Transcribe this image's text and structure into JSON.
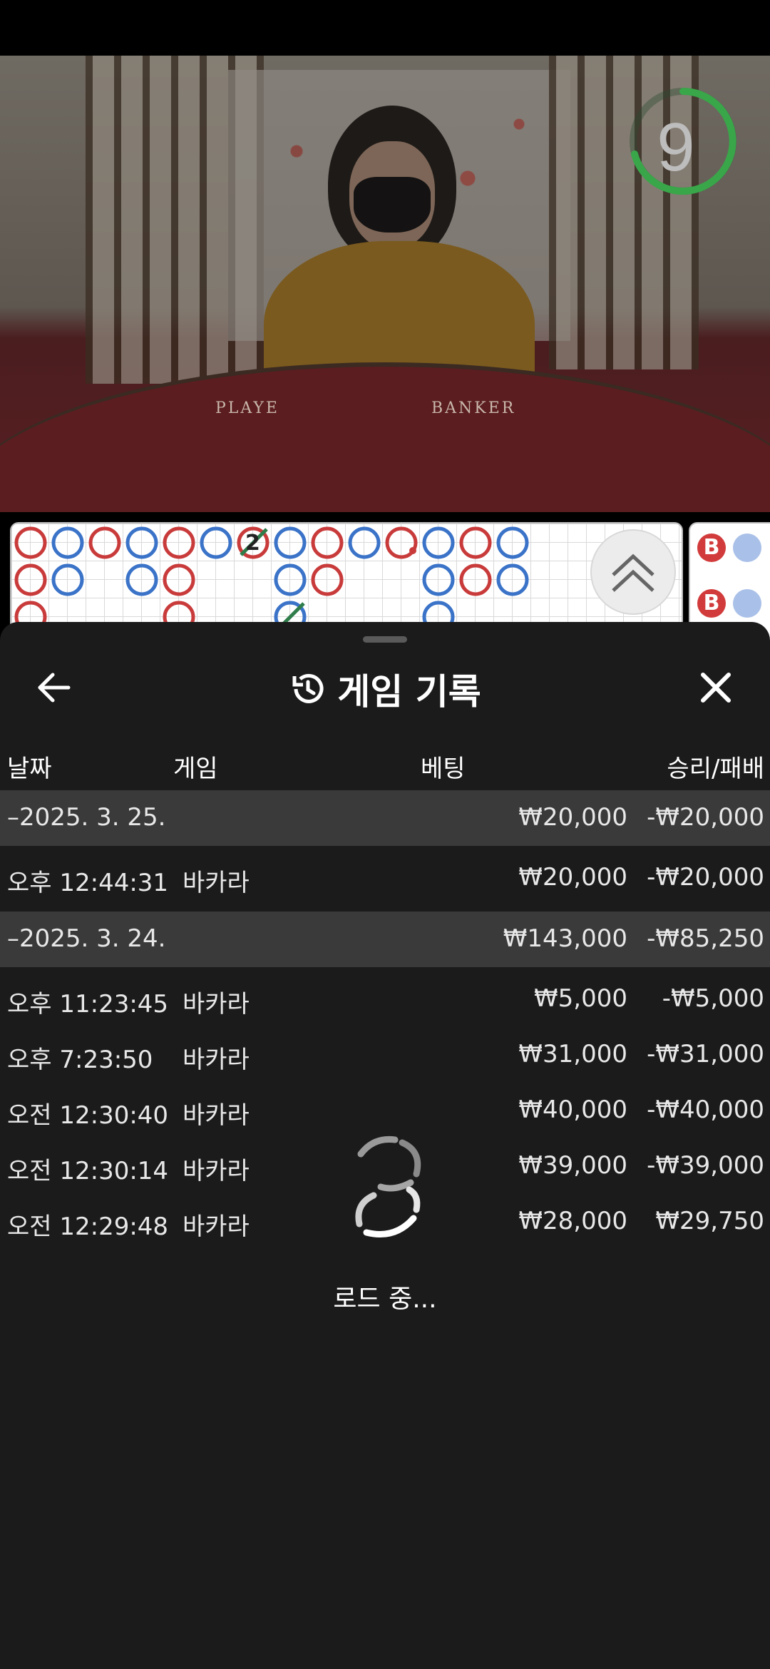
{
  "live_table": {
    "timer": "9",
    "table_labels": [
      "PLAYE",
      "BANKER"
    ],
    "roadmap_tie_count": "2",
    "side_beads": [
      "B",
      "B"
    ]
  },
  "history_panel": {
    "title": "게임 기록",
    "columns": {
      "date": "날짜",
      "game": "게임",
      "bet": "베팅",
      "winloss": "승리/패배"
    },
    "groups": [
      {
        "date": "–2025. 3. 25.",
        "bet_total": "₩20,000",
        "winloss_total": "-₩20,000",
        "rows": [
          {
            "time": "오후 12:44:31",
            "game": "바카라",
            "bet": "₩20,000",
            "winloss": "-₩20,000"
          }
        ]
      },
      {
        "date": "–2025. 3. 24.",
        "bet_total": "₩143,000",
        "winloss_total": "-₩85,250",
        "rows": [
          {
            "time": "오후 11:23:45",
            "game": "바카라",
            "bet": "₩5,000",
            "winloss": "-₩5,000"
          },
          {
            "time": "오후 7:23:50",
            "game": "바카라",
            "bet": "₩31,000",
            "winloss": "-₩31,000"
          },
          {
            "time": "오전 12:30:40",
            "game": "바카라",
            "bet": "₩40,000",
            "winloss": "-₩40,000"
          },
          {
            "time": "오전 12:30:14",
            "game": "바카라",
            "bet": "₩39,000",
            "winloss": "-₩39,000"
          },
          {
            "time": "오전 12:29:48",
            "game": "바카라",
            "bet": "₩28,000",
            "winloss": "₩29,750"
          }
        ]
      }
    ],
    "loading_text": "로드 중...",
    "icons": {
      "back": "arrow-left-icon",
      "history": "history-clock-icon",
      "close": "close-icon",
      "expand": "chevron-double-up-icon",
      "loader": "spinner-icon"
    }
  },
  "colors": {
    "sheet_bg": "#1b1b1b",
    "date_row_bg": "#3a3a3a",
    "banker_red": "#d23b3b",
    "player_blue": "#3a73c8",
    "timer_green": "#3aa64a"
  }
}
